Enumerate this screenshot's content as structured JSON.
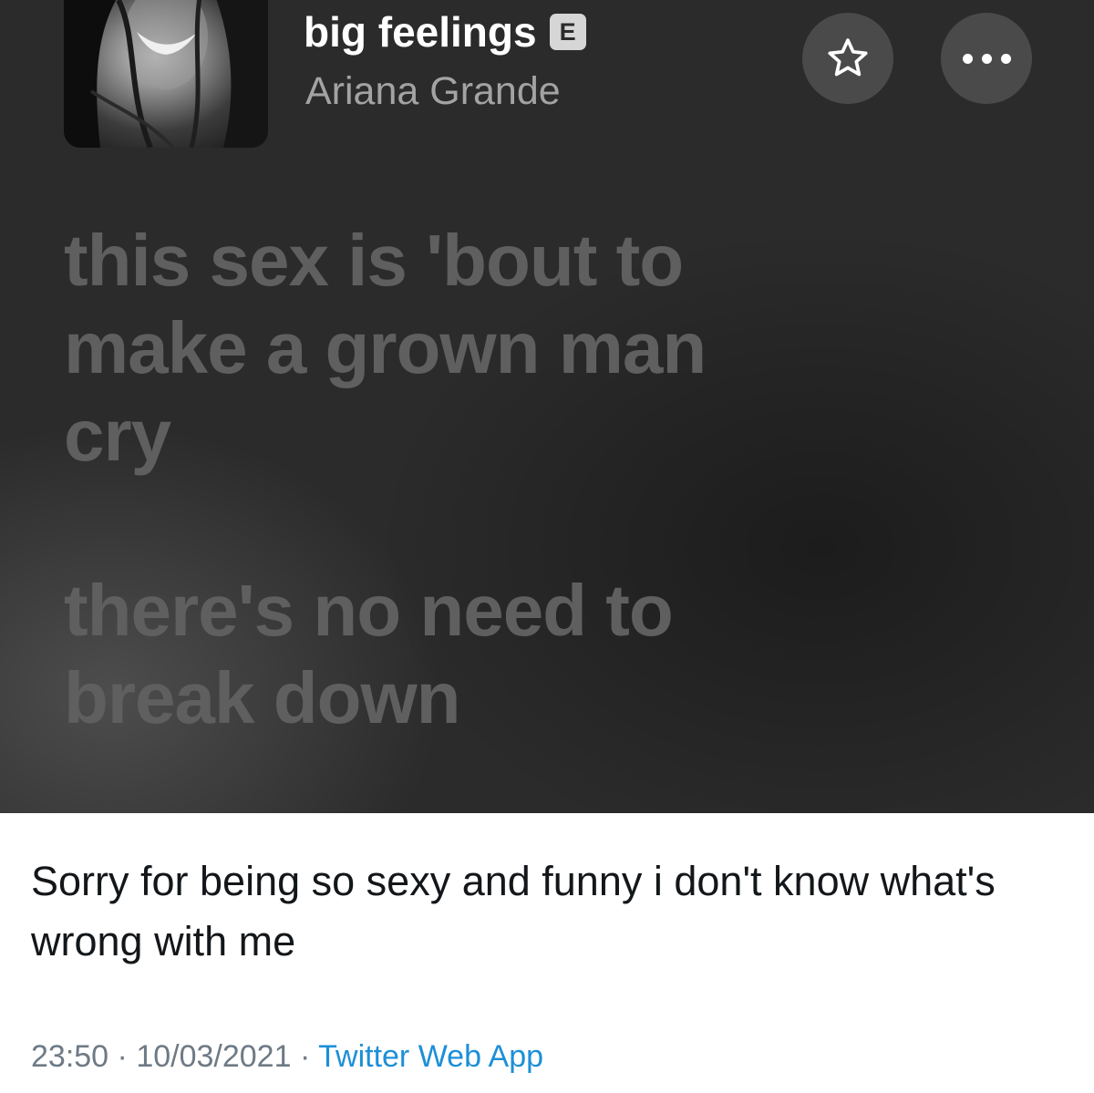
{
  "player": {
    "song_title": "big feelings",
    "explicit_badge": "E",
    "artist": "Ariana Grande",
    "favorite_icon": "star-outline-icon",
    "more_icon": "more-horizontal-icon"
  },
  "lyrics": {
    "lines": [
      "this sex is 'bout to",
      "make a grown man",
      "cry",
      "",
      "there's no need to",
      "break down"
    ]
  },
  "tweet": {
    "text": "Sorry for being so sexy and funny i don't know what's wrong with me",
    "time": "23:50",
    "separator": "·",
    "date": "10/03/2021",
    "source": "Twitter Web App"
  },
  "colors": {
    "player_background": "#2b2b2b",
    "lyric_text": "#5f5f5f",
    "artist_text": "#a3a3a3",
    "tweet_source_link": "#1d8fd8"
  }
}
